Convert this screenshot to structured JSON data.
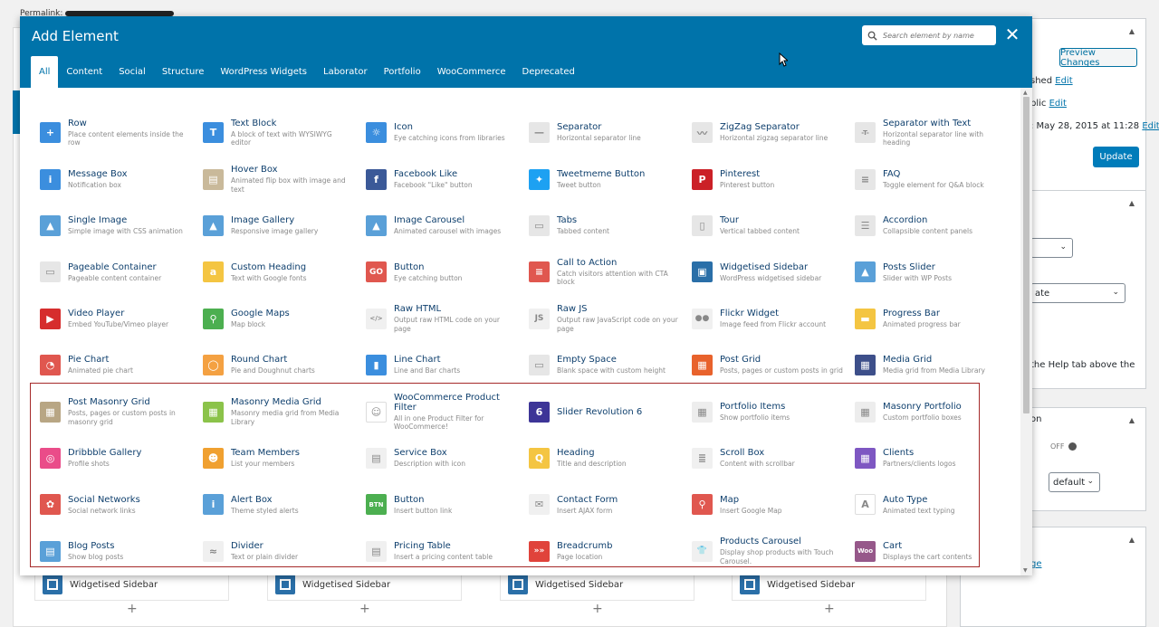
{
  "background": {
    "permalink_label": "Permalink:",
    "preview_button": "Preview Changes",
    "publish_rows": [
      {
        "text": "shed",
        "link": "Edit"
      },
      {
        "text": "blic",
        "link": "Edit"
      },
      {
        "text": ": May 28, 2015 at 11:28",
        "link": "Edit"
      }
    ],
    "update_button": "Update",
    "select_template": "ate",
    "help_text": "the Help tab above the",
    "section_label": "on",
    "toggle_label": "OFF",
    "select_default": "default",
    "bottom_link": "ge",
    "bottom_card_label": "Widgetised Sidebar",
    "bottom_plus": "+"
  },
  "modal": {
    "title": "Add Element",
    "search_placeholder": "Search element by name",
    "close_label": "✕",
    "tabs": [
      "All",
      "Content",
      "Social",
      "Structure",
      "WordPress Widgets",
      "Laborator",
      "Portfolio",
      "WooCommerce",
      "Deprecated"
    ],
    "active_tab": "All",
    "elements": [
      {
        "name": "Row",
        "desc": "Place content elements inside the row",
        "icon": "plus-icon",
        "color": "#3b8ede",
        "glyph": "+"
      },
      {
        "name": "Text Block",
        "desc": "A block of text with WYSIWYG editor",
        "icon": "text-block-icon",
        "color": "#3b8ede",
        "glyph": "T"
      },
      {
        "name": "Icon",
        "desc": "Eye catching icons from libraries",
        "icon": "sun-icon",
        "color": "#3b8ede",
        "glyph": "☼"
      },
      {
        "name": "Separator",
        "desc": "Horizontal separator line",
        "icon": "separator-icon",
        "color": "#e6e6e6",
        "glyph": "—"
      },
      {
        "name": "ZigZag Separator",
        "desc": "Horizontal zigzag separator line",
        "icon": "zigzag-icon",
        "color": "#e6e6e6",
        "glyph": "〰"
      },
      {
        "name": "Separator with Text",
        "desc": "Horizontal separator line with heading",
        "icon": "separator-text-icon",
        "color": "#e6e6e6",
        "glyph": "-T-"
      },
      {
        "name": "Message Box",
        "desc": "Notification box",
        "icon": "info-icon",
        "color": "#3b8ede",
        "glyph": "i"
      },
      {
        "name": "Hover Box",
        "desc": "Animated flip box with image and text",
        "icon": "hover-box-icon",
        "color": "#c9b99a",
        "glyph": "▤"
      },
      {
        "name": "Facebook Like",
        "desc": "Facebook \"Like\" button",
        "icon": "facebook-icon",
        "color": "#3b5998",
        "glyph": "f"
      },
      {
        "name": "Tweetmeme Button",
        "desc": "Tweet button",
        "icon": "twitter-icon",
        "color": "#1da1f2",
        "glyph": "✦"
      },
      {
        "name": "Pinterest",
        "desc": "Pinterest button",
        "icon": "pinterest-icon",
        "color": "#cb2027",
        "glyph": "P"
      },
      {
        "name": "FAQ",
        "desc": "Toggle element for Q&A block",
        "icon": "faq-icon",
        "color": "#e6e6e6",
        "glyph": "≡"
      },
      {
        "name": "Single Image",
        "desc": "Simple image with CSS animation",
        "icon": "image-icon",
        "color": "#5aa0d8",
        "glyph": "▲"
      },
      {
        "name": "Image Gallery",
        "desc": "Responsive image gallery",
        "icon": "gallery-icon",
        "color": "#5aa0d8",
        "glyph": "▲"
      },
      {
        "name": "Image Carousel",
        "desc": "Animated carousel with images",
        "icon": "carousel-icon",
        "color": "#5aa0d8",
        "glyph": "▲"
      },
      {
        "name": "Tabs",
        "desc": "Tabbed content",
        "icon": "tabs-icon",
        "color": "#e6e6e6",
        "glyph": "▭"
      },
      {
        "name": "Tour",
        "desc": "Vertical tabbed content",
        "icon": "tour-icon",
        "color": "#e6e6e6",
        "glyph": "▯"
      },
      {
        "name": "Accordion",
        "desc": "Collapsible content panels",
        "icon": "accordion-icon",
        "color": "#e6e6e6",
        "glyph": "☰"
      },
      {
        "name": "Pageable Container",
        "desc": "Pageable content container",
        "icon": "pageable-icon",
        "color": "#e6e6e6",
        "glyph": "▭"
      },
      {
        "name": "Custom Heading",
        "desc": "Text with Google fonts",
        "icon": "heading-a-icon",
        "color": "#f4c542",
        "glyph": "a"
      },
      {
        "name": "Button",
        "desc": "Eye catching button",
        "icon": "go-button-icon",
        "color": "#e0574f",
        "glyph": "GO"
      },
      {
        "name": "Call to Action",
        "desc": "Catch visitors attention with CTA block",
        "icon": "cta-icon",
        "color": "#e0574f",
        "glyph": "≡"
      },
      {
        "name": "Widgetised Sidebar",
        "desc": "WordPress widgetised sidebar",
        "icon": "sidebar-icon",
        "color": "#2a6fa8",
        "glyph": "▣"
      },
      {
        "name": "Posts Slider",
        "desc": "Slider with WP Posts",
        "icon": "posts-slider-icon",
        "color": "#5aa0d8",
        "glyph": "▲"
      },
      {
        "name": "Video Player",
        "desc": "Embed YouTube/Vimeo player",
        "icon": "play-icon",
        "color": "#d62d2d",
        "glyph": "▶"
      },
      {
        "name": "Google Maps",
        "desc": "Map block",
        "icon": "map-pin-icon",
        "color": "#4caf50",
        "glyph": "⚲"
      },
      {
        "name": "Raw HTML",
        "desc": "Output raw HTML code on your page",
        "icon": "html-file-icon",
        "color": "#f0f0f0",
        "glyph": "</>"
      },
      {
        "name": "Raw JS",
        "desc": "Output raw JavaScript code on your page",
        "icon": "js-file-icon",
        "color": "#f0f0f0",
        "glyph": "JS"
      },
      {
        "name": "Flickr Widget",
        "desc": "Image feed from Flickr account",
        "icon": "flickr-icon",
        "color": "#f0f0f0",
        "glyph": "●●"
      },
      {
        "name": "Progress Bar",
        "desc": "Animated progress bar",
        "icon": "progress-bar-icon",
        "color": "#f4c542",
        "glyph": "▬"
      },
      {
        "name": "Pie Chart",
        "desc": "Animated pie chart",
        "icon": "pie-chart-icon",
        "color": "#e0574f",
        "glyph": "◔"
      },
      {
        "name": "Round Chart",
        "desc": "Pie and Doughnut charts",
        "icon": "round-chart-icon",
        "color": "#f4a142",
        "glyph": "◯"
      },
      {
        "name": "Line Chart",
        "desc": "Line and Bar charts",
        "icon": "line-chart-icon",
        "color": "#3b8ede",
        "glyph": "▮"
      },
      {
        "name": "Empty Space",
        "desc": "Blank space with custom height",
        "icon": "empty-space-icon",
        "color": "#e6e6e6",
        "glyph": "▭"
      },
      {
        "name": "Post Grid",
        "desc": "Posts, pages or custom posts in grid",
        "icon": "post-grid-icon",
        "color": "#e8622c",
        "glyph": "▦"
      },
      {
        "name": "Media Grid",
        "desc": "Media grid from Media Library",
        "icon": "media-grid-icon",
        "color": "#3d4f8a",
        "glyph": "▦"
      },
      {
        "name": "Post Masonry Grid",
        "desc": "Posts, pages or custom posts in masonry grid",
        "icon": "masonry-grid-icon",
        "color": "#b8a684",
        "glyph": "▦"
      },
      {
        "name": "Masonry Media Grid",
        "desc": "Masonry media grid from Media Library",
        "icon": "masonry-media-icon",
        "color": "#8bc34a",
        "glyph": "▦"
      },
      {
        "name": "WooCommerce Product Filter",
        "desc": "All in one Product Filter for WooCommerce!",
        "icon": "product-filter-icon",
        "color": "#ffffff",
        "glyph": "☺"
      },
      {
        "name": "Slider Revolution 6",
        "desc": "",
        "icon": "slider-revolution-icon",
        "color": "#3d3597",
        "glyph": "6"
      },
      {
        "name": "Portfolio Items",
        "desc": "Show portfolio items",
        "icon": "portfolio-items-icon",
        "color": "#ededed",
        "glyph": "▦"
      },
      {
        "name": "Masonry Portfolio",
        "desc": "Custom portfolio boxes",
        "icon": "masonry-portfolio-icon",
        "color": "#ededed",
        "glyph": "▦"
      },
      {
        "name": "Dribbble Gallery",
        "desc": "Profile shots",
        "icon": "dribbble-icon",
        "color": "#ea4c89",
        "glyph": "◎"
      },
      {
        "name": "Team Members",
        "desc": "List your members",
        "icon": "team-members-icon",
        "color": "#f0a030",
        "glyph": "☻"
      },
      {
        "name": "Service Box",
        "desc": "Description with icon",
        "icon": "service-box-icon",
        "color": "#f0f0f0",
        "glyph": "▤"
      },
      {
        "name": "Heading",
        "desc": "Title and description",
        "icon": "heading-q-icon",
        "color": "#f4c542",
        "glyph": "Q"
      },
      {
        "name": "Scroll Box",
        "desc": "Content with scrollbar",
        "icon": "scroll-box-icon",
        "color": "#f0f0f0",
        "glyph": "≣"
      },
      {
        "name": "Clients",
        "desc": "Partners/clients logos",
        "icon": "clients-icon",
        "color": "#7e57c2",
        "glyph": "▦"
      },
      {
        "name": "Social Networks",
        "desc": "Social network links",
        "icon": "social-networks-icon",
        "color": "#e0574f",
        "glyph": "✿"
      },
      {
        "name": "Alert Box",
        "desc": "Theme styled alerts",
        "icon": "alert-icon",
        "color": "#5aa0d8",
        "glyph": "i"
      },
      {
        "name": "Button",
        "desc": "Insert button link",
        "icon": "button-link-icon",
        "color": "#4caf50",
        "glyph": "BTN"
      },
      {
        "name": "Contact Form",
        "desc": "Insert AJAX form",
        "icon": "envelope-icon",
        "color": "#f0f0f0",
        "glyph": "✉"
      },
      {
        "name": "Map",
        "desc": "Insert Google Map",
        "icon": "map-marker-icon",
        "color": "#e0574f",
        "glyph": "⚲"
      },
      {
        "name": "Auto Type",
        "desc": "Animated text typing",
        "icon": "auto-type-icon",
        "color": "#ffffff",
        "glyph": "A"
      },
      {
        "name": "Blog Posts",
        "desc": "Show blog posts",
        "icon": "blog-posts-icon",
        "color": "#5aa0d8",
        "glyph": "▤"
      },
      {
        "name": "Divider",
        "desc": "Text or plain divider",
        "icon": "divider-icon",
        "color": "#f0f0f0",
        "glyph": "≈"
      },
      {
        "name": "Pricing Table",
        "desc": "Insert a pricing content table",
        "icon": "pricing-table-icon",
        "color": "#f0f0f0",
        "glyph": "▤"
      },
      {
        "name": "Breadcrumb",
        "desc": "Page location",
        "icon": "breadcrumb-icon",
        "color": "#e0433b",
        "glyph": "»»"
      },
      {
        "name": "Products Carousel",
        "desc": "Display shop products with Touch Carousel.",
        "icon": "products-carousel-icon",
        "color": "#f0f0f0",
        "glyph": "👕"
      },
      {
        "name": "Cart",
        "desc": "Displays the cart contents",
        "icon": "woo-cart-icon",
        "color": "#96588a",
        "glyph": "Woo"
      }
    ]
  }
}
